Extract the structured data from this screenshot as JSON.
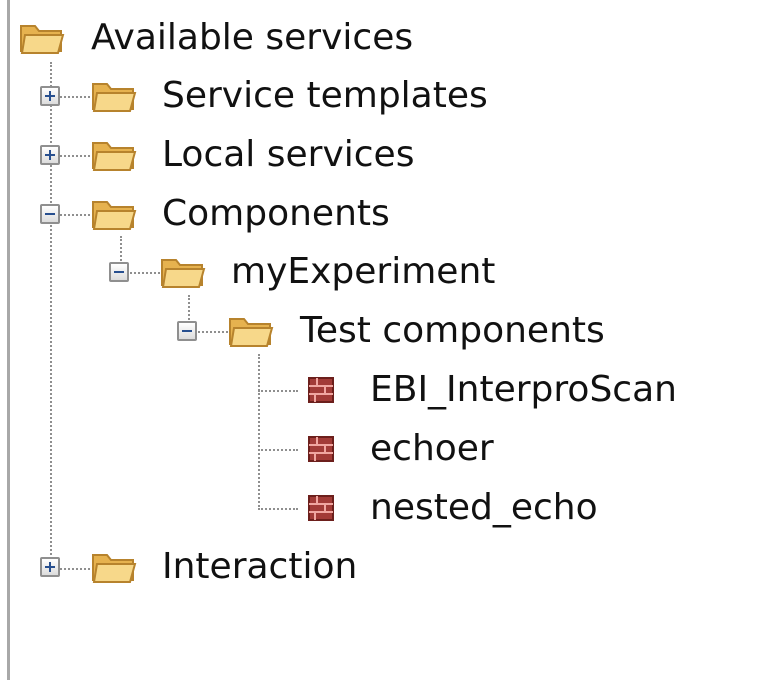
{
  "tree": {
    "root": {
      "label": "Available services",
      "icon": "folder-open-icon"
    },
    "service_templates": {
      "label": "Service templates",
      "icon": "folder-open-icon",
      "expanded": false
    },
    "local_services": {
      "label": "Local services",
      "icon": "folder-open-icon",
      "expanded": false
    },
    "components": {
      "label": "Components",
      "icon": "folder-open-icon",
      "expanded": true
    },
    "my_experiment": {
      "label": "myExperiment",
      "icon": "folder-open-icon",
      "expanded": true
    },
    "test_components": {
      "label": "Test components",
      "icon": "folder-open-icon",
      "expanded": true
    },
    "leaf_items": [
      {
        "label": "EBI_InterproScan",
        "icon": "component-brick-icon"
      },
      {
        "label": "echoer",
        "icon": "component-brick-icon"
      },
      {
        "label": "nested_echo",
        "icon": "component-brick-icon"
      }
    ],
    "interaction": {
      "label": "Interaction",
      "icon": "folder-open-icon",
      "expanded": false
    }
  },
  "colors": {
    "folder_back": "#e6b24f",
    "folder_front": "#f7d88a",
    "folder_edge": "#b7832d",
    "component": "#a23b37",
    "component_edge": "#6c1f1c",
    "tree_line": "#8f8f8f"
  }
}
